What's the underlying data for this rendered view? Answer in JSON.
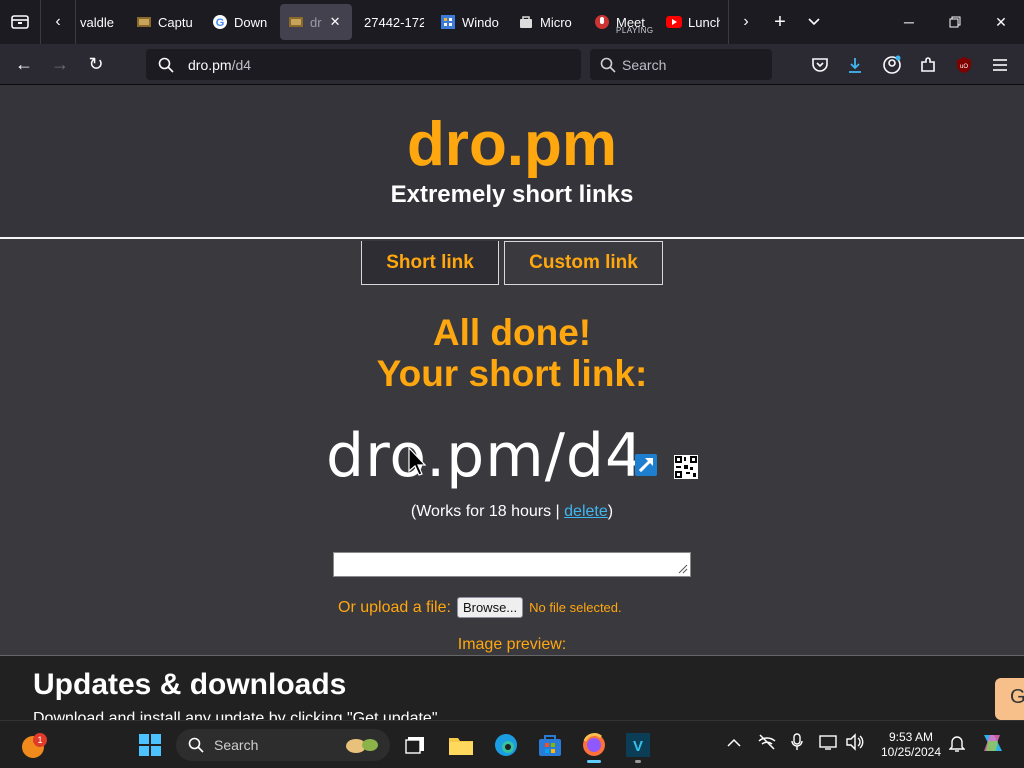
{
  "browser": {
    "tabs": [
      {
        "title": "valdle"
      },
      {
        "title": "Captu"
      },
      {
        "title": "Down"
      },
      {
        "title": "dr"
      },
      {
        "title": "27442-172"
      },
      {
        "title": "Windo"
      },
      {
        "title": "Micro"
      },
      {
        "title": "Meet",
        "sub": "PLAYING"
      },
      {
        "title": "Lunch"
      }
    ],
    "url_host": "dro.pm",
    "url_path": "/d4",
    "search_placeholder": "Search"
  },
  "site": {
    "logo": "dro.pm",
    "tagline": "Extremely short links",
    "tabs": [
      "Short link",
      "Custom link"
    ],
    "done_line1": "All done!",
    "done_line2": "Your short link:",
    "short_link": "dro.pm/d4",
    "works_prefix": "(Works for 18 hours | ",
    "delete_label": "delete",
    "works_suffix": ")",
    "upload_label": "Or upload a file:",
    "browse_label": "Browse...",
    "no_file": "No file selected.",
    "preview_label": "Image preview:",
    "updates_title": "Updates & downloads",
    "updates_text": "Download and install any update by clicking \"Get update\"",
    "updates_btn": "G"
  },
  "taskbar": {
    "search_placeholder": "Search",
    "notification_badge": "1",
    "time": "9:53 AM",
    "date": "10/25/2024"
  },
  "colors": {
    "accent": "#ffa70f",
    "link": "#3fb6f0",
    "page_bg": "#3a393e"
  }
}
